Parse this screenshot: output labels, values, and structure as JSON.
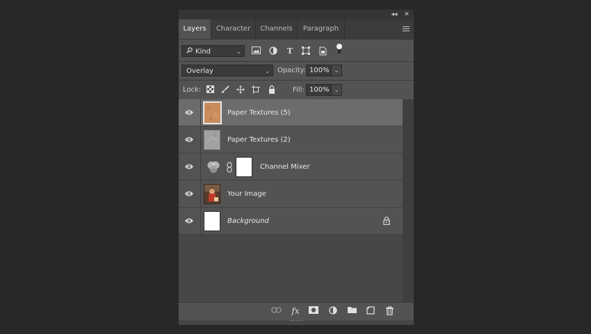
{
  "panel": {
    "collapse_label": "◂◂",
    "close_label": "✕"
  },
  "tabs": [
    {
      "label": "Layers"
    },
    {
      "label": "Character"
    },
    {
      "label": "Channels"
    },
    {
      "label": "Paragraph"
    }
  ],
  "filter": {
    "kind_label": "Kind",
    "icons": [
      "image-filter-icon",
      "adjustment-filter-icon",
      "type-filter-icon",
      "shape-filter-icon",
      "smart-object-filter-icon",
      "filter-toggle-icon"
    ]
  },
  "blend": {
    "mode": "Overlay",
    "opacity_label": "Opacity:",
    "opacity_value": "100%"
  },
  "lock": {
    "label": "Lock:",
    "fill_label": "Fill:",
    "fill_value": "100%"
  },
  "layers": [
    {
      "name": "Paper Textures (5)",
      "selected": true,
      "thumb": "paper-orange"
    },
    {
      "name": "Paper Textures (2)",
      "selected": false,
      "thumb": "paper-gray"
    },
    {
      "name": "Channel Mixer",
      "selected": false,
      "thumb": "adjustment"
    },
    {
      "name": "Your Image",
      "selected": false,
      "thumb": "photo"
    },
    {
      "name": "Background",
      "selected": false,
      "thumb": "white",
      "locked": true
    }
  ],
  "bottom_icons": [
    "link-layers-icon",
    "fx-icon",
    "add-mask-icon",
    "new-adjustment-icon",
    "new-group-icon",
    "new-layer-icon",
    "delete-layer-icon"
  ],
  "fx_label": "fx"
}
